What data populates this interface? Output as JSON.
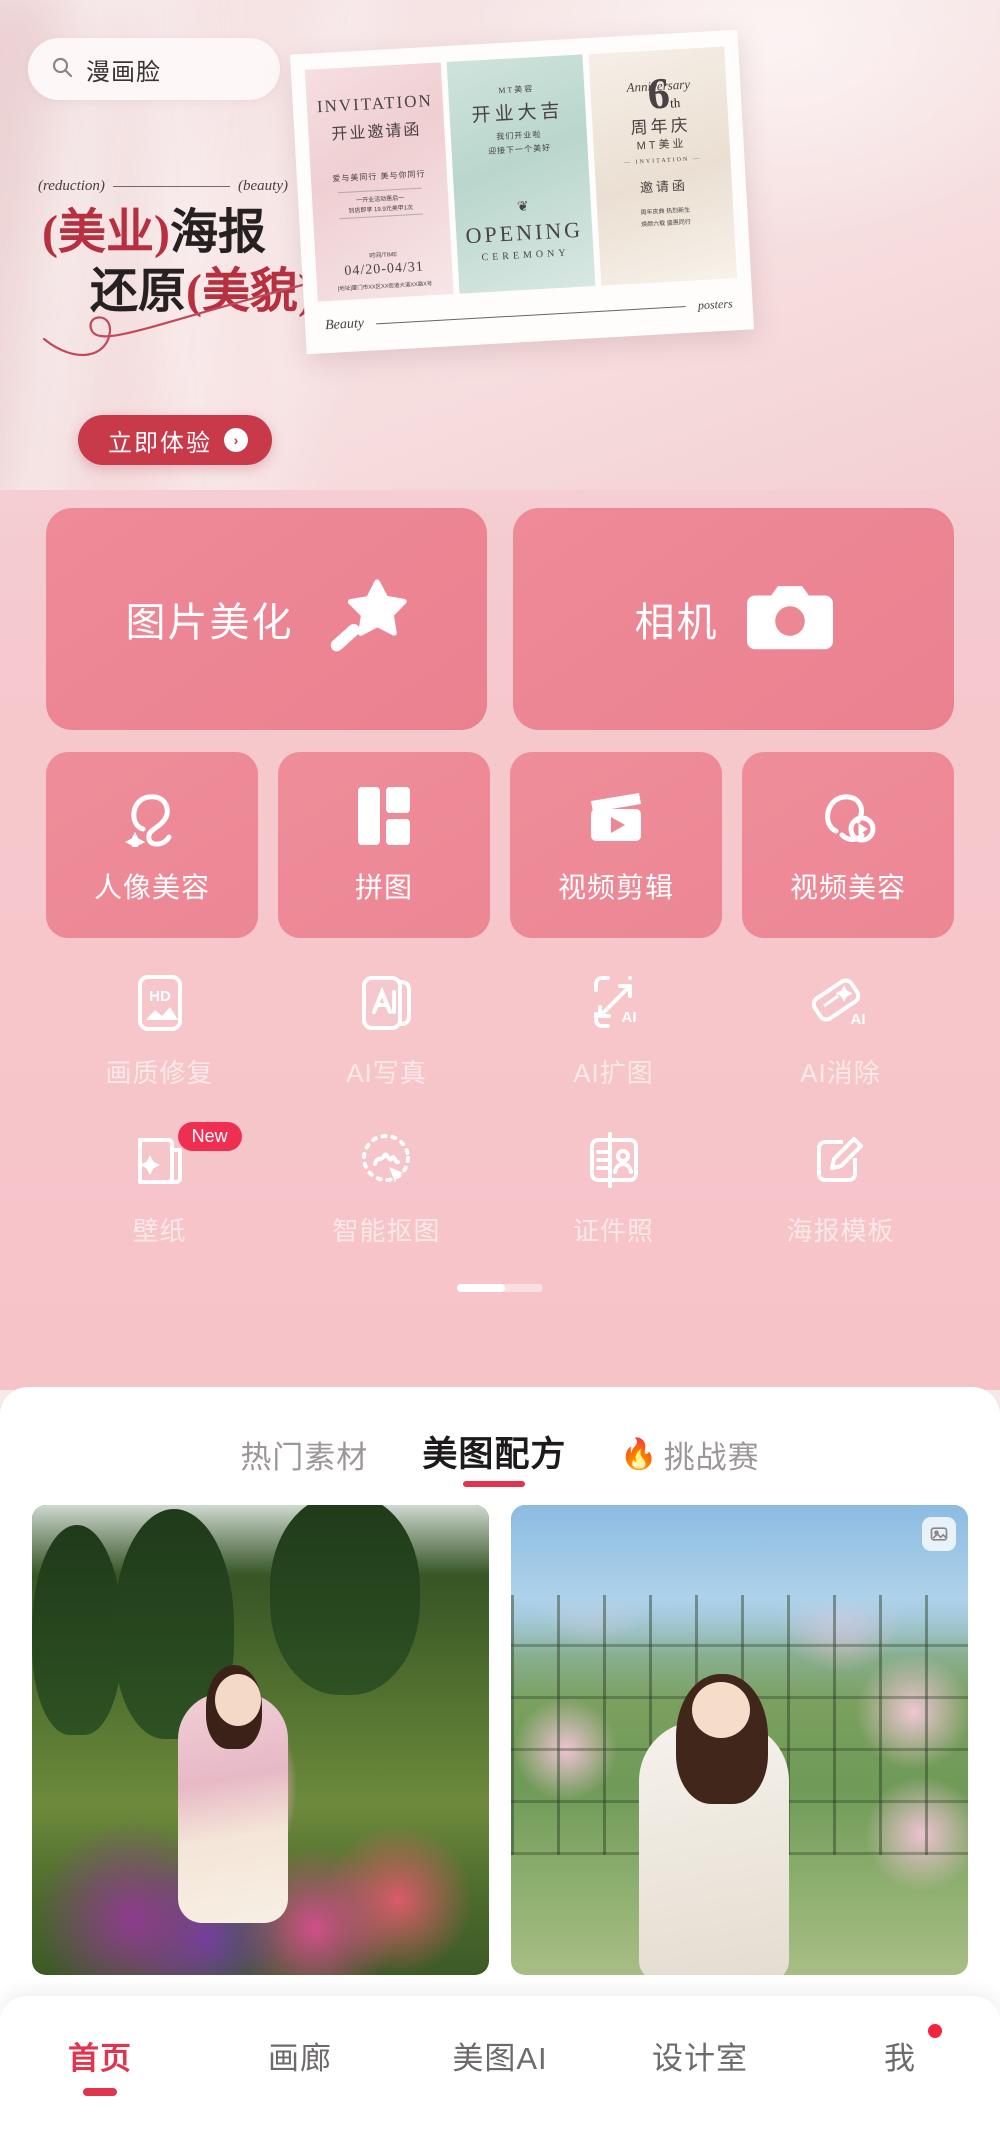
{
  "search": {
    "icon": "search-icon",
    "query": "漫画脸"
  },
  "hero": {
    "eyebrow_left": "(reduction)",
    "eyebrow_right": "(beauty)",
    "headline_line1_accent": "(美业)",
    "headline_line1_rest": "海报",
    "headline_line2_rest": "还原",
    "headline_line2_accent": "(美貌)",
    "cta_label": "立即体验",
    "cta_arrow": "›",
    "poster_card": {
      "poster1": {
        "title_en": "INVITATION",
        "title_cn": "开业邀请函",
        "subtitle": "爱与美同行 美与你同行",
        "note1": "一开业活动惠后一",
        "note2": "到店即享 19.9元美甲1次",
        "time_badge": "时间/TIME",
        "date": "04/20-04/31",
        "footer": "[地址]厦门市XX区XX街道大道XX路X号"
      },
      "poster2": {
        "brand": "MT美容",
        "title": "开业大吉",
        "sub1": "我们开业啦",
        "sub2": "迎接下一个美好",
        "ornament": "❦",
        "big_en": "OPENING",
        "small_en": "CEREMONY"
      },
      "poster3": {
        "number": "6",
        "ordinal": "th",
        "script": "Anniversary",
        "anniversary": "周年庆",
        "brand": "MT美业",
        "brand_en": "— INVITATION —",
        "invitation": "邀请函",
        "blurb1": "周年庆典 热烈新生",
        "blurb2": "焕颜六载 盛惠同行"
      },
      "footer_left": "Beauty",
      "footer_right": "posters"
    }
  },
  "features": {
    "big_tiles": [
      {
        "label": "图片美化",
        "icon": "magic-wand-icon"
      },
      {
        "label": "相机",
        "icon": "camera-icon"
      }
    ],
    "mid_tiles": [
      {
        "label": "人像美容",
        "icon": "portrait-beauty-icon"
      },
      {
        "label": "拼图",
        "icon": "collage-icon"
      },
      {
        "label": "视频剪辑",
        "icon": "video-clip-icon"
      },
      {
        "label": "视频美容",
        "icon": "video-beauty-icon"
      }
    ],
    "small_items": [
      {
        "label": "画质修复",
        "icon": "hd-restore-icon",
        "badge": ""
      },
      {
        "label": "AI写真",
        "icon": "ai-portrait-icon",
        "badge": ""
      },
      {
        "label": "AI扩图",
        "icon": "ai-expand-icon",
        "badge": ""
      },
      {
        "label": "AI消除",
        "icon": "ai-erase-icon",
        "badge": ""
      },
      {
        "label": "壁纸",
        "icon": "wallpaper-icon",
        "badge": "New"
      },
      {
        "label": "智能抠图",
        "icon": "smart-cutout-icon",
        "badge": ""
      },
      {
        "label": "证件照",
        "icon": "id-photo-icon",
        "badge": ""
      },
      {
        "label": "海报模板",
        "icon": "poster-template-icon",
        "badge": ""
      }
    ]
  },
  "tabs": [
    {
      "label": "热门素材",
      "active": false,
      "icon": ""
    },
    {
      "label": "美图配方",
      "active": true,
      "icon": ""
    },
    {
      "label": "挑战赛",
      "active": false,
      "icon": "fire-icon"
    }
  ],
  "feed": [
    {
      "name": "garden-portrait-card",
      "corner_icon": ""
    },
    {
      "name": "rose-portrait-card",
      "corner_icon": "image-stack-icon"
    }
  ],
  "bottom_nav": [
    {
      "label": "首页",
      "active": true,
      "dot": false
    },
    {
      "label": "画廊",
      "active": false,
      "dot": false
    },
    {
      "label": "美图AI",
      "active": false,
      "dot": false
    },
    {
      "label": "设计室",
      "active": false,
      "dot": false
    },
    {
      "label": "我",
      "active": false,
      "dot": true
    }
  ],
  "colors": {
    "accent_red": "#e1354f",
    "cta_red": "#c8394a",
    "tile_pink": "#ec8794",
    "section_pink": "#f6c6cb",
    "badge_red": "#ef2f52"
  }
}
